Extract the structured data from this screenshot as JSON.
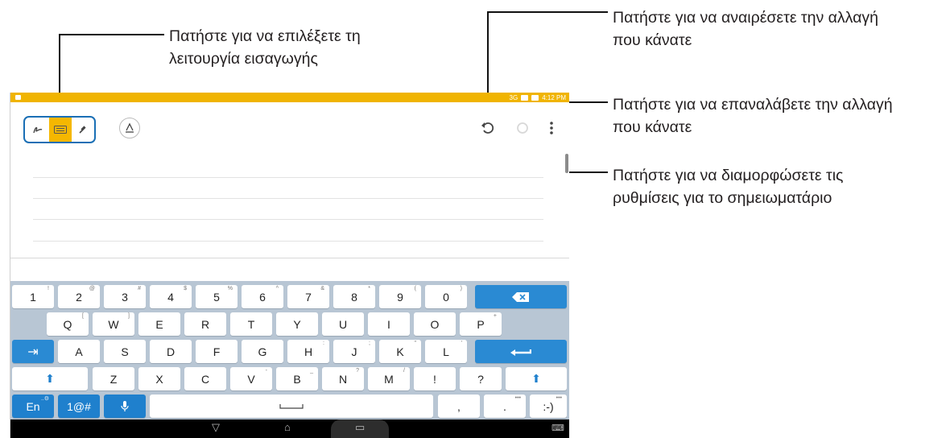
{
  "callouts": {
    "mode_line1": "Πατήστε για να επιλέξετε τη",
    "mode_line2": "λειτουργία εισαγωγής",
    "undo_line1": "Πατήστε για να αναιρέσετε την αλλαγή",
    "undo_line2": "που κάνατε",
    "redo_line1": "Πατήστε για να επαναλάβετε την αλλαγή",
    "redo_line2": "που κάνατε",
    "settings_line1": "Πατήστε για να διαμορφώσετε τις",
    "settings_line2": "ρυθμίσεις για το σημειωματάριο"
  },
  "status": {
    "time": "4:12 PM",
    "network": "3G",
    "color": "#f0b400"
  },
  "toolbar": {
    "icons": {
      "handwrite": "handwriting-icon",
      "keyboard": "keyboard-icon",
      "draw": "pen-icon",
      "style": "text-style-icon",
      "undo": "undo-icon",
      "redo": "redo-icon",
      "more": "more-vertical-icon"
    },
    "accent": "#f5b700",
    "group_border": "#1a6fb5"
  },
  "keyboard": {
    "row1": [
      {
        "label": "1",
        "sup": "!"
      },
      {
        "label": "2",
        "sup": "@"
      },
      {
        "label": "3",
        "sup": "#"
      },
      {
        "label": "4",
        "sup": "$"
      },
      {
        "label": "5",
        "sup": "%"
      },
      {
        "label": "6",
        "sup": "^"
      },
      {
        "label": "7",
        "sup": "&"
      },
      {
        "label": "8",
        "sup": "*"
      },
      {
        "label": "9",
        "sup": "("
      },
      {
        "label": "0",
        "sup": ")"
      }
    ],
    "row2": [
      {
        "label": "Q",
        "sup": "["
      },
      {
        "label": "W",
        "sup": "]"
      },
      {
        "label": "E",
        "sup": ""
      },
      {
        "label": "R",
        "sup": ""
      },
      {
        "label": "T",
        "sup": ""
      },
      {
        "label": "Y",
        "sup": ""
      },
      {
        "label": "U",
        "sup": ""
      },
      {
        "label": "I",
        "sup": ""
      },
      {
        "label": "O",
        "sup": ""
      },
      {
        "label": "P",
        "sup": "+"
      }
    ],
    "row3": [
      {
        "label": "A",
        "sup": ""
      },
      {
        "label": "S",
        "sup": ""
      },
      {
        "label": "D",
        "sup": ""
      },
      {
        "label": "F",
        "sup": ""
      },
      {
        "label": "G",
        "sup": ""
      },
      {
        "label": "H",
        "sup": ":"
      },
      {
        "label": "J",
        "sup": ";"
      },
      {
        "label": "K",
        "sup": "\""
      },
      {
        "label": "L",
        "sup": "'"
      }
    ],
    "row4": [
      {
        "label": "Z",
        "sup": ""
      },
      {
        "label": "X",
        "sup": ""
      },
      {
        "label": "C",
        "sup": ""
      },
      {
        "label": "V",
        "sup": "-"
      },
      {
        "label": "B",
        "sup": "_"
      },
      {
        "label": "N",
        "sup": "?"
      },
      {
        "label": "M",
        "sup": "/"
      },
      {
        "label": "!",
        "sup": ""
      },
      {
        "label": "?",
        "sup": ""
      }
    ],
    "lang": "En",
    "lang_sup": "..⚙",
    "symbols": "1@#",
    "comma": ",",
    "period": ".",
    "period_sup": "•••",
    "smiley": ":-)",
    "smiley_sup": "•••",
    "backspace": "⌫",
    "enter": "⏎",
    "tab": "⇥",
    "shift": "⬆",
    "mic": "🎤",
    "space": "⎵",
    "key_color": "#2a8ad3",
    "bg_color": "#b8c6d4"
  },
  "navbar": {
    "back": "▽",
    "home": "⌂",
    "recents": "▭",
    "keyboard": "⌨"
  }
}
